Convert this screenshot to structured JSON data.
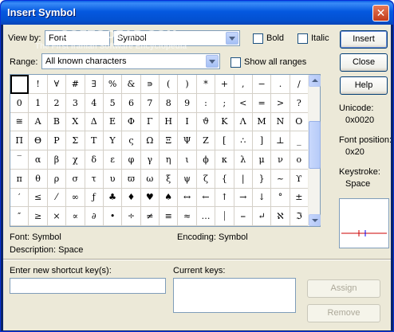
{
  "window": {
    "title": "Insert Symbol",
    "close_glyph": "✕"
  },
  "view_by": {
    "label": "View by:",
    "mode": "Font",
    "font": "Symbol"
  },
  "checkboxes": {
    "bold": "Bold",
    "italic": "Italic",
    "show_all_ranges": "Show all ranges"
  },
  "range": {
    "label": "Range:",
    "value": "All known characters"
  },
  "buttons": {
    "insert": "Insert",
    "close": "Close",
    "help": "Help",
    "assign": "Assign",
    "remove": "Remove"
  },
  "symbol_grid": [
    [
      "",
      "!",
      "∀",
      "#",
      "∃",
      "%",
      "&",
      "∍",
      "(",
      ")",
      "*",
      "+",
      ",",
      "−",
      ".",
      "/"
    ],
    [
      "0",
      "1",
      "2",
      "3",
      "4",
      "5",
      "6",
      "7",
      "8",
      "9",
      ":",
      ";",
      "<",
      "=",
      ">",
      "?"
    ],
    [
      "≅",
      "Α",
      "Β",
      "Χ",
      "Δ",
      "Ε",
      "Φ",
      "Γ",
      "Η",
      "Ι",
      "ϑ",
      "Κ",
      "Λ",
      "Μ",
      "Ν",
      "Ο"
    ],
    [
      "Π",
      "Θ",
      "Ρ",
      "Σ",
      "Τ",
      "Υ",
      "ς",
      "Ω",
      "Ξ",
      "Ψ",
      "Ζ",
      "[",
      "∴",
      "]",
      "⊥",
      "_"
    ],
    [
      "‾",
      "α",
      "β",
      "χ",
      "δ",
      "ε",
      "φ",
      "γ",
      "η",
      "ι",
      "ϕ",
      "κ",
      "λ",
      "μ",
      "ν",
      "ο"
    ],
    [
      "π",
      "θ",
      "ρ",
      "σ",
      "τ",
      "υ",
      "ϖ",
      "ω",
      "ξ",
      "ψ",
      "ζ",
      "{",
      "|",
      "}",
      "~",
      "ϒ"
    ],
    [
      "′",
      "≤",
      "⁄",
      "∞",
      "ƒ",
      "♣",
      "♦",
      "♥",
      "♠",
      "↔",
      "←",
      "↑",
      "→",
      "↓",
      "°",
      "±"
    ],
    [
      "″",
      "≥",
      "×",
      "∝",
      "∂",
      "•",
      "÷",
      "≠",
      "≡",
      "≈",
      "…",
      "⏐",
      "⎯",
      "↵",
      "ℵ",
      "ℑ"
    ]
  ],
  "info": {
    "unicode_label": "Unicode:",
    "unicode_value": "0x0020",
    "font_position_label": "Font position:",
    "font_position_value": "0x20",
    "keystroke_label": "Keystroke:",
    "keystroke_value": "Space"
  },
  "status": {
    "font": "Font:  Symbol",
    "encoding": "Encoding:  Symbol",
    "description": "Description:  Space"
  },
  "shortcut": {
    "new_label": "Enter new shortcut key(s):",
    "current_label": "Current keys:",
    "new_value": ""
  },
  "watermark": {
    "line1": "SOFTGOZAR.COM",
    "line2": "The First Iranian Software Encyclopedia"
  }
}
